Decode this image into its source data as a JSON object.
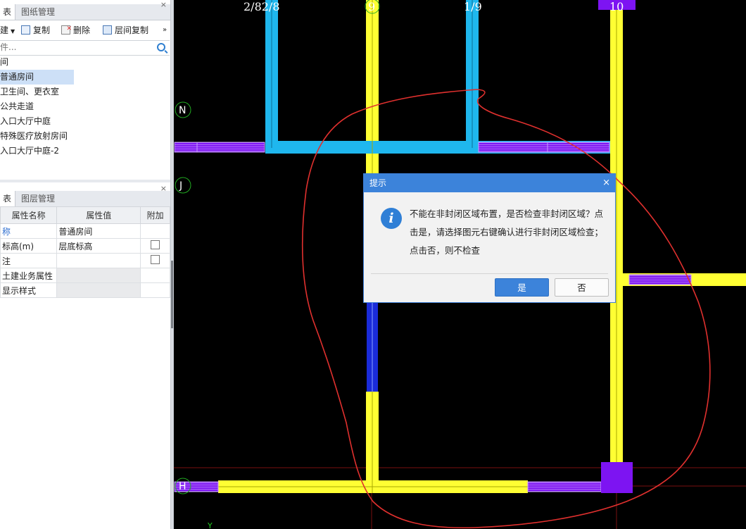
{
  "left_panel": {
    "top_tabs": {
      "active": "表",
      "inactive": "图纸管理",
      "close": "×"
    },
    "toolbar": {
      "first": "建",
      "copy": "复制",
      "delete": "删除",
      "layer_copy": "层间复制",
      "more": "»"
    },
    "search": {
      "placeholder": "件..."
    },
    "tree": {
      "items": [
        "间",
        "普通房间",
        "卫生间、更衣室",
        "公共走道",
        "入口大厅中庭",
        "特殊医疗放射房间",
        "入口大厅中庭-2"
      ],
      "selected_index": 1
    },
    "bottom_tabs": {
      "active": "表",
      "inactive": "图层管理",
      "close": "×"
    },
    "props": {
      "headers": [
        "属性名称",
        "属性值",
        "附加"
      ],
      "rows": [
        {
          "name": "称",
          "value": "普通房间",
          "check": false
        },
        {
          "name": "标高(m)",
          "value": "层底标高",
          "check": true
        },
        {
          "name": "注",
          "value": "",
          "check": true
        },
        {
          "name": "土建业务属性",
          "value": "",
          "check": false
        },
        {
          "name": "显示样式",
          "value": "",
          "check": false
        }
      ]
    }
  },
  "canvas": {
    "axis_labels": {
      "top_1": "2/82/8",
      "top_2": "9",
      "top_3": "1/9",
      "top_4": "10",
      "left_N": "N",
      "left_J": "J",
      "left_H": "H",
      "y_marker": "Y"
    }
  },
  "dialog": {
    "title": "提示",
    "close": "×",
    "icon": "i",
    "message": "不能在非封闭区域布置，是否检查非封闭区域？点击是，请选择图元右键确认进行非封闭区域检查；点击否，则不检查",
    "yes": "是",
    "no": "否"
  },
  "colors": {
    "wall_yellow": "#ffff33",
    "wall_cyan": "#1fb7ee",
    "purple": "#7d14f2",
    "dialog_blue": "#3c83da",
    "red_annotation": "#e0302e"
  }
}
